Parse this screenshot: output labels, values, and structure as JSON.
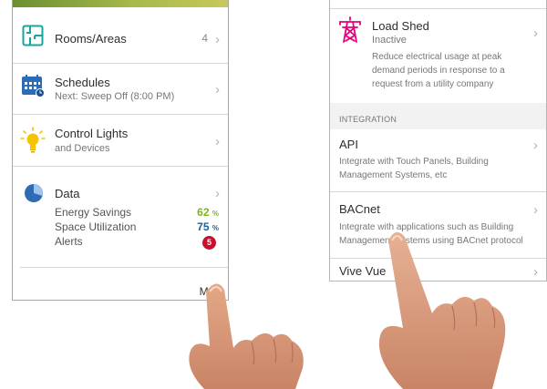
{
  "left_panel": {
    "rooms": {
      "label": "Rooms/Areas",
      "count": "4",
      "icon": "floorplan-icon"
    },
    "schedules": {
      "label": "Schedules",
      "subtitle": "Next: Sweep Off (8:00 PM)",
      "icon": "calendar-icon"
    },
    "lights": {
      "label": "Control Lights",
      "subtitle": "and Devices",
      "icon": "lightbulb-icon"
    },
    "data": {
      "label": "Data",
      "icon": "pie-chart-icon",
      "stats": [
        {
          "label": "Energy Savings",
          "value": "62",
          "unit": "%",
          "color": "#7ab51d"
        },
        {
          "label": "Space Utilization",
          "value": "75",
          "unit": "%",
          "color": "#1d5e9e"
        },
        {
          "label": "Alerts",
          "value": "5",
          "color": "#c8102e"
        }
      ]
    },
    "more_label": "More"
  },
  "right_panel": {
    "load_shed": {
      "label": "Load Shed",
      "status": "Inactive",
      "description": "Reduce electrical usage at peak demand periods in response to a request from a utility company",
      "icon": "power-tower-icon"
    },
    "section_label": "INTEGRATION",
    "items": [
      {
        "label": "API",
        "description": "Integrate with Touch Panels, Building Management Systems, etc"
      },
      {
        "label": "BACnet",
        "description": "Integrate with applications such as Building Management Systems using BACnet protocol"
      },
      {
        "label": "Vive Vue"
      }
    ]
  },
  "colors": {
    "accent_green": "#7ab51d",
    "accent_blue": "#1d5e9e",
    "alert_red": "#c8102e",
    "icon_pink": "#e5007d",
    "bulb_yellow": "#f5c400"
  }
}
